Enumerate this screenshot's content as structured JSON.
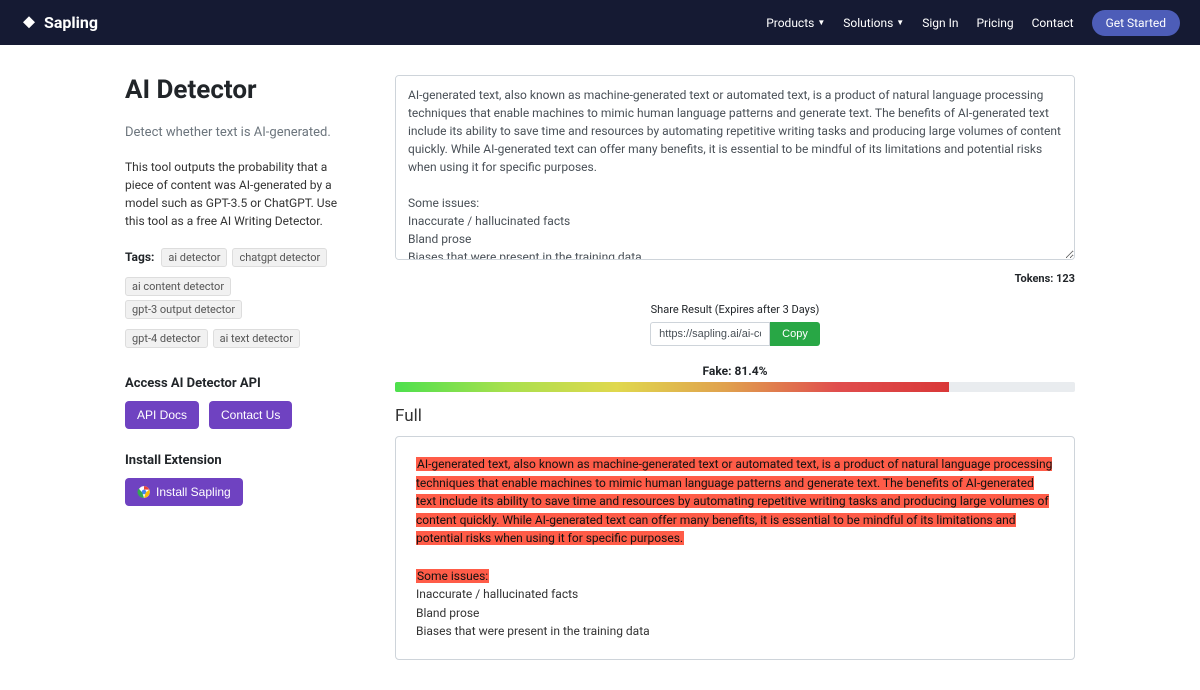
{
  "nav": {
    "brand": "Sapling",
    "products": "Products",
    "solutions": "Solutions",
    "signin": "Sign In",
    "pricing": "Pricing",
    "contact": "Contact",
    "getstarted": "Get Started"
  },
  "page": {
    "title": "AI Detector",
    "subtitle": "Detect whether text is AI-generated.",
    "description": "This tool outputs the probability that a piece of content was AI-generated by a model such as GPT-3.5 or ChatGPT. Use this tool as a free AI Writing Detector.",
    "tags_label": "Tags:",
    "tags": [
      "ai detector",
      "chatgpt detector",
      "ai content detector",
      "gpt-3 output detector",
      "gpt-4 detector",
      "ai text detector"
    ],
    "api_title": "Access AI Detector API",
    "api_docs": "API Docs",
    "contact_us": "Contact Us",
    "install_title": "Install Extension",
    "install_btn": "Install Sapling"
  },
  "input": {
    "text": "AI-generated text, also known as machine-generated text or automated text, is a product of natural language processing techniques that enable machines to mimic human language patterns and generate text. The benefits of AI-generated text include its ability to save time and resources by automating repetitive writing tasks and producing large volumes of content quickly. While AI-generated text can offer many benefits, it is essential to be mindful of its limitations and potential risks when using it for specific purposes.\n\nSome issues:\nInaccurate / hallucinated facts\nBland prose\nBiases that were present in the training data"
  },
  "tokens_label": "Tokens: 123",
  "share": {
    "label": "Share Result (Expires after 3 Days)",
    "url": "https://sapling.ai/ai-content-dete",
    "copy": "Copy"
  },
  "result": {
    "fake_label": "Fake: 81.4%",
    "fake_pct": 81.4,
    "full_title": "Full",
    "hl1": "AI-generated text, also known as machine-generated text or automated text, is a product of natural language processing techniques that enable machines to mimic human language patterns and generate text. The benefits of AI-generated text include its ability to save time and resources by automating repetitive writing tasks and producing large volumes of content quickly. While AI-generated text can offer many benefits, it is essential to be mindful of its limitations and potential risks when using it for specific purposes.",
    "hl2": "Some issues:",
    "line1": "Inaccurate / hallucinated facts",
    "line2": "Bland prose",
    "line3": "Biases that were present in the training data"
  }
}
